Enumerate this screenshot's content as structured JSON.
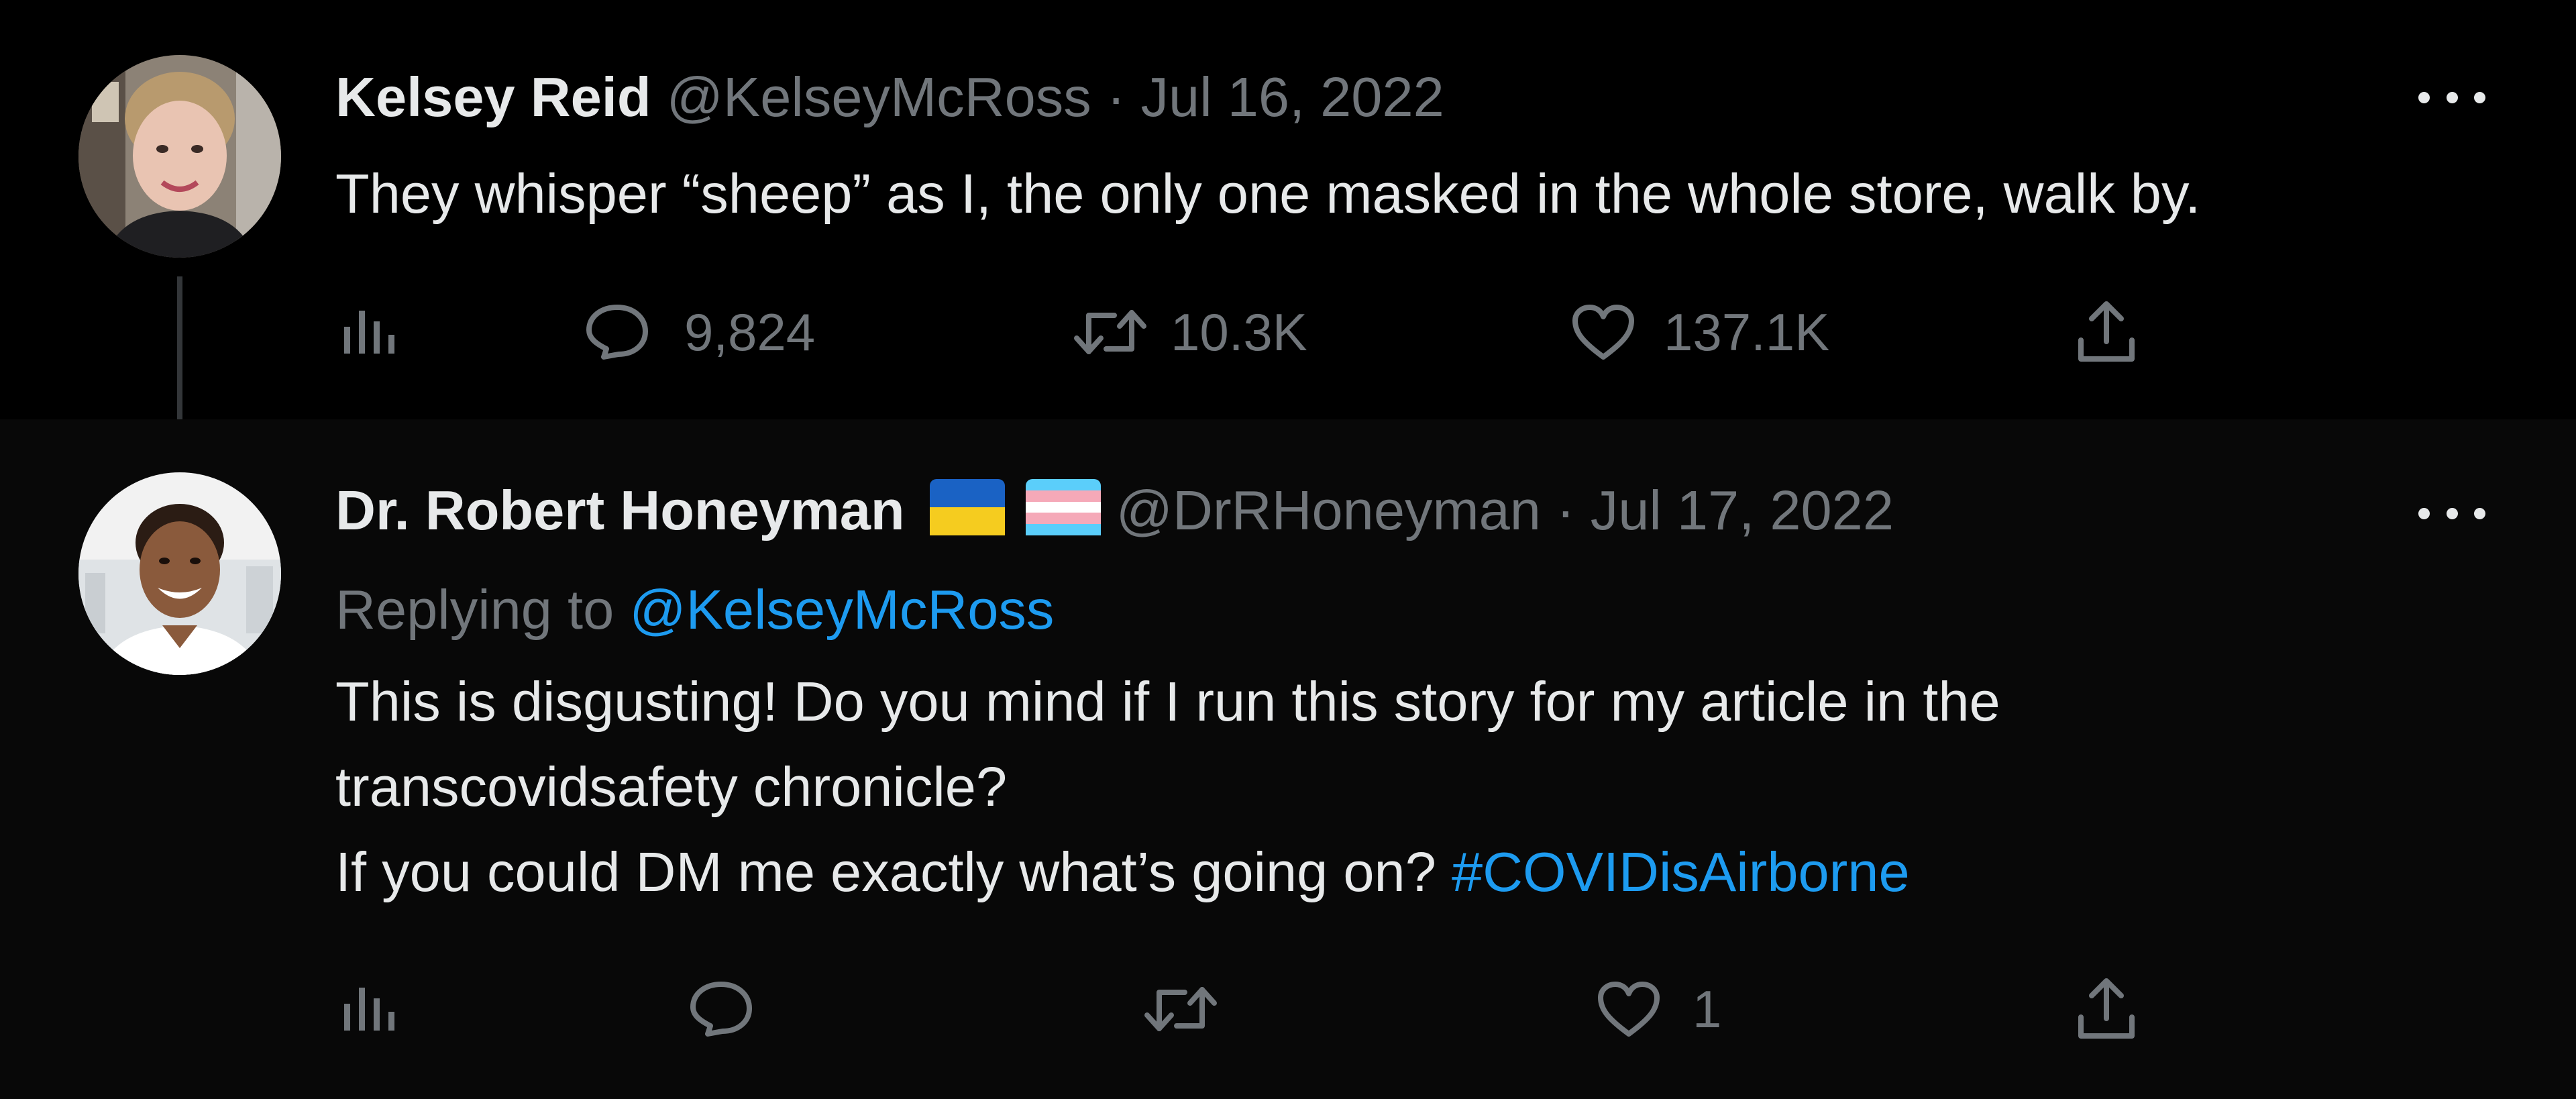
{
  "tweets": [
    {
      "name": "Kelsey Reid",
      "handle": "@KelseyMcRoss",
      "separator": "·",
      "date": "Jul 16, 2022",
      "text": "They whisper “sheep” as I, the only one masked in the whole store, walk by.",
      "replies": "9,824",
      "retweets": "10.3K",
      "likes": "137.1K"
    },
    {
      "name": "Dr. Robert Honeyman",
      "handle": "@DrRHoneyman",
      "separator": "·",
      "date": "Jul 17, 2022",
      "replying_prefix": "Replying to",
      "replying_to": "@KelseyMcRoss",
      "text_line1": "This is disgusting! Do you mind if I run this story for my article in the",
      "text_line2": "transcovidsafety chronicle?",
      "text_line3": "If you could DM me exactly what’s going on?",
      "hashtag": "#COVIDisAirborne",
      "likes": "1"
    }
  ],
  "icons": [
    "analytics-icon",
    "reply-icon",
    "retweet-icon",
    "like-icon",
    "share-icon",
    "more-icon",
    "ukraine-flag-icon",
    "transgender-flag-icon"
  ],
  "colors": {
    "background": "#000000",
    "text": "#e7e9ea",
    "muted": "#71767b",
    "link": "#1d9bf0"
  }
}
